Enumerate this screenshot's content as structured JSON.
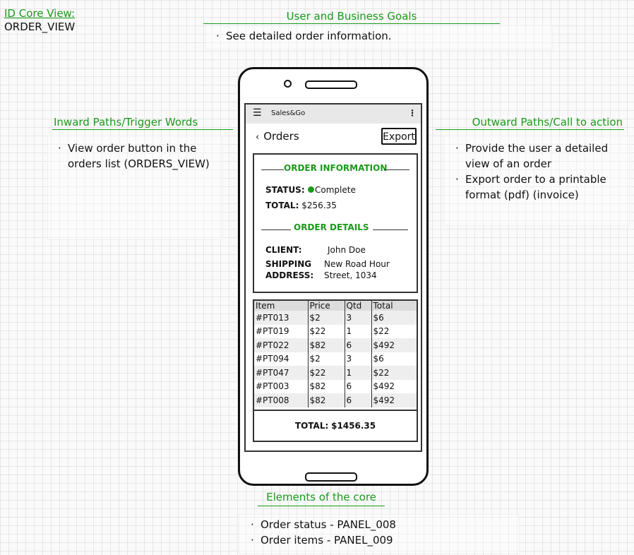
{
  "core_view": {
    "id_label": "ID Core View:",
    "id_value": "ORDER_VIEW"
  },
  "goals": {
    "title": "User and Business Goals",
    "items": [
      "See detailed order information."
    ]
  },
  "inward": {
    "title": "Inward Paths/Trigger Words",
    "items": [
      "View order button in the orders list (ORDERS_VIEW)"
    ]
  },
  "outward": {
    "title": "Outward Paths/Call to action",
    "items": [
      "Provide the user a detailed view of an order",
      "Export order to a printable format (pdf) (invoice)"
    ]
  },
  "elements": {
    "title": "Elements of the core",
    "items": [
      "Order status - PANEL_008",
      "Order items - PANEL_009"
    ]
  },
  "app": {
    "menu_icon": "hamburger-menu-icon",
    "name": "Sales&Go",
    "more_icon": "vertical-dots-icon",
    "back_label": "Orders",
    "export_label": "Export"
  },
  "order_info": {
    "title": "ORDER INFORMATION",
    "status_label": "STATUS:",
    "status_value": "Complete",
    "status_color": "#1a9a1a",
    "total_label": "TOTAL:",
    "total_value": "$256.35"
  },
  "order_details": {
    "title": "ORDER DETAILS",
    "client_label": "CLIENT:",
    "client_value": "John Doe",
    "shipping_label_1": "SHIPPING",
    "shipping_label_2": "ADDRESS:",
    "shipping_value_1": "New Road Hour",
    "shipping_value_2": "Street, 1034"
  },
  "items_table": {
    "headers": [
      "Item",
      "Price",
      "Qtd",
      "Total"
    ],
    "rows": [
      [
        "#PT013",
        "$2",
        "3",
        "$6"
      ],
      [
        "#PT019",
        "$22",
        "1",
        "$22"
      ],
      [
        "#PT022",
        "$82",
        "6",
        "$492"
      ],
      [
        "#PT094",
        "$2",
        "3",
        "$6"
      ],
      [
        "#PT047",
        "$22",
        "1",
        "$22"
      ],
      [
        "#PT003",
        "$82",
        "6",
        "$492"
      ],
      [
        "#PT008",
        "$82",
        "6",
        "$492"
      ]
    ]
  },
  "grand_total": {
    "label": "TOTAL:",
    "value": "$1456.35"
  }
}
